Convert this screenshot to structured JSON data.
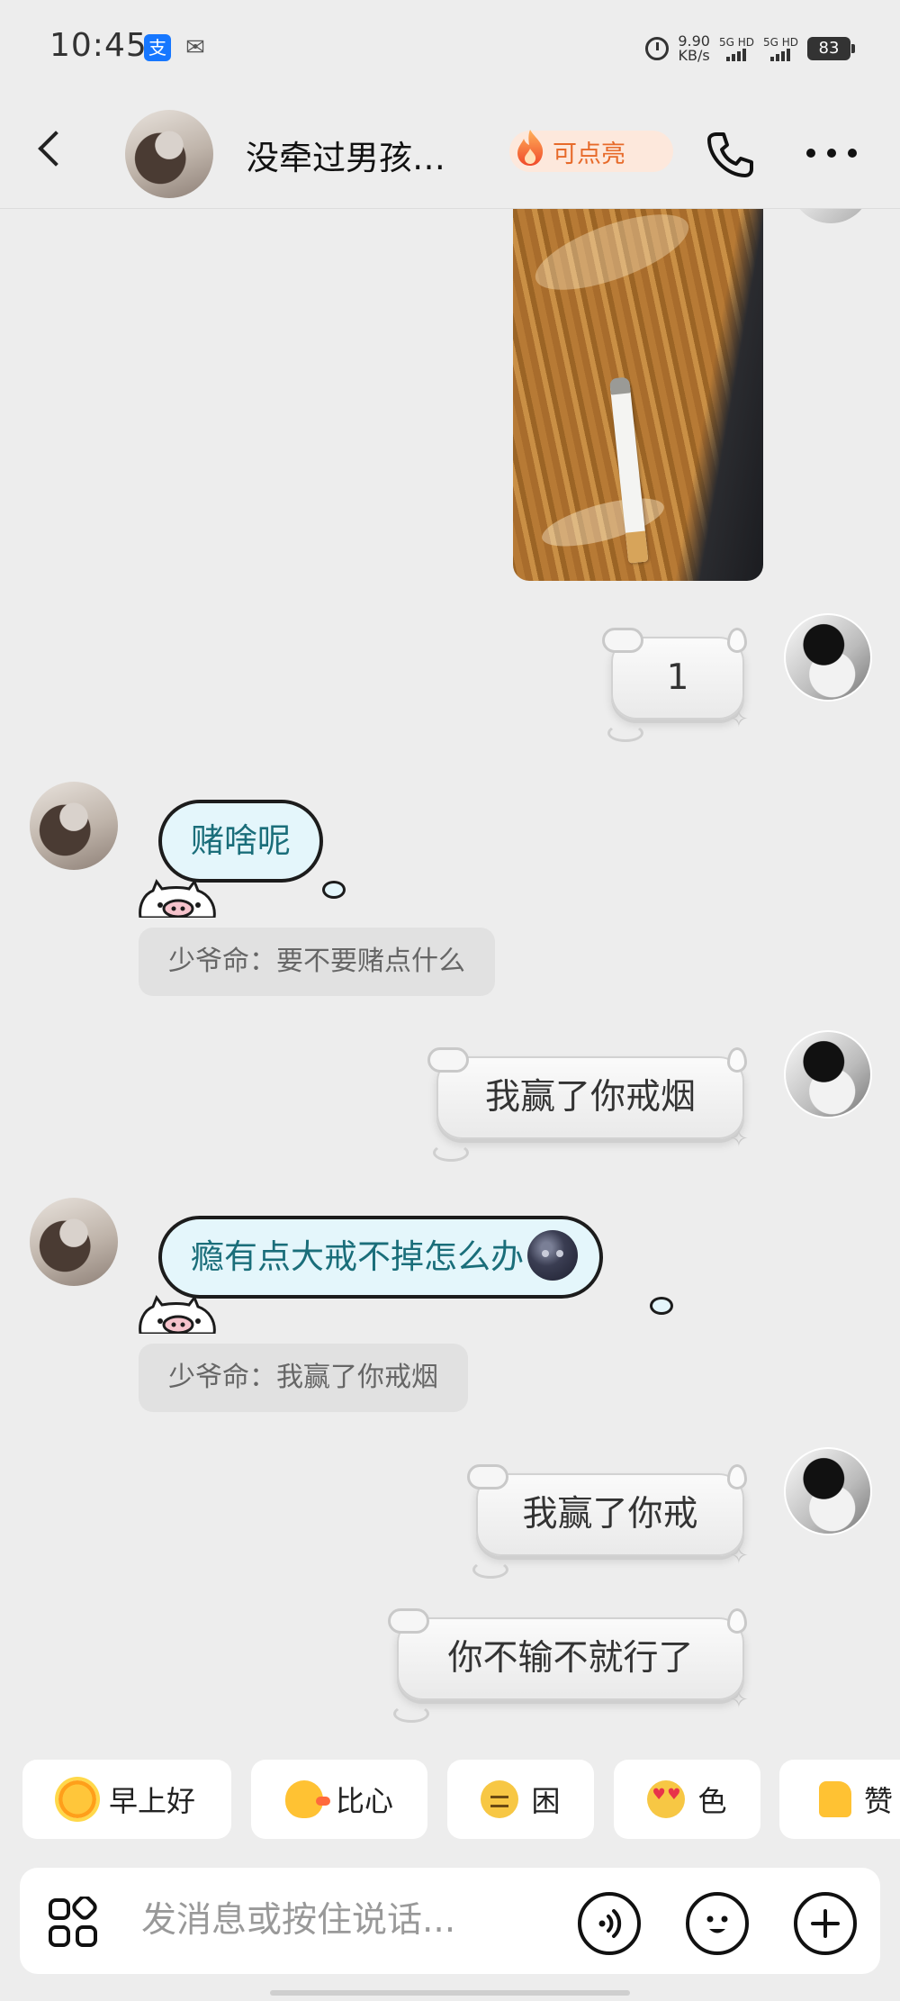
{
  "status_bar": {
    "time": "10:45",
    "alipay_icon": "alipay-icon",
    "wechat_icon": "wechat-icon",
    "net_speed_value": "9.90",
    "net_speed_unit": "KB/s",
    "signal1_label": "5G HD",
    "signal2_label": "5G HD",
    "battery": "83"
  },
  "header": {
    "title": "没牵过男孩…",
    "light_label": "可点亮",
    "icons": [
      "back-icon",
      "flame-icon",
      "phone-icon",
      "more-icon"
    ]
  },
  "messages": [
    {
      "side": "right",
      "type": "image",
      "description_icon": "photo"
    },
    {
      "side": "right",
      "type": "text",
      "text": "1"
    },
    {
      "side": "left",
      "type": "text",
      "text": "赌啥呢",
      "quote": "少爷命：要不要赌点什么"
    },
    {
      "side": "right",
      "type": "text",
      "text": "我赢了你戒烟"
    },
    {
      "side": "left",
      "type": "text",
      "text": "瘾有点大戒不掉怎么办",
      "emoji": "moon-face-icon",
      "quote": "少爷命：我赢了你戒烟"
    },
    {
      "side": "right",
      "type": "text",
      "text": "我赢了你戒"
    },
    {
      "side": "right",
      "type": "text",
      "text": "你不输不就行了"
    }
  ],
  "quick_replies": [
    {
      "label": "早上好",
      "icon": "sun-emoji-icon"
    },
    {
      "label": "比心",
      "icon": "duck-emoji-icon"
    },
    {
      "label": "困",
      "icon": "sleepy-emoji-icon"
    },
    {
      "label": "色",
      "icon": "heart-eyes-emoji-icon"
    },
    {
      "label": "赞",
      "icon": "thumbs-up-emoji-icon"
    }
  ],
  "input_bar": {
    "placeholder": "发消息或按住说话...",
    "icons": [
      "apps-icon",
      "voice-icon",
      "emoji-icon",
      "plus-icon"
    ]
  }
}
